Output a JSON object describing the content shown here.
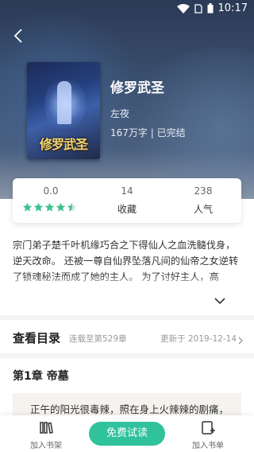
{
  "status_bar": {
    "time": "10:17"
  },
  "book": {
    "title": "修罗武圣",
    "author": "左夜",
    "meta": "167万字 | 已完结",
    "cover_title": "修罗武圣"
  },
  "stats": {
    "rating": {
      "value": "0.0",
      "stars": 4.5
    },
    "favorites": {
      "value": "14",
      "label": "收藏"
    },
    "popularity": {
      "value": "238",
      "label": "人气"
    }
  },
  "description": "宗门弟子楚千叶机缘巧合之下得仙人之血洗髓伐身，逆天改命。 还被一尊自仙界坠落凡间的仙帝之女逆转了锁魂秘法而成了她的主人。 为了讨好主人，高",
  "catalog": {
    "title": "查看目录",
    "serial": "连载至第529章",
    "updated": "更新于 2019-12-14"
  },
  "chapter": {
    "title": "第1章 帝墓",
    "preview": "正午的阳光很毒辣，照在身上火辣辣的剧痛，"
  },
  "bottom_bar": {
    "add_shelf": "加入书架",
    "read": "免费试读",
    "add_list": "加入书单"
  },
  "colors": {
    "accent": "#2fc29c",
    "star": "#3cc48e"
  }
}
